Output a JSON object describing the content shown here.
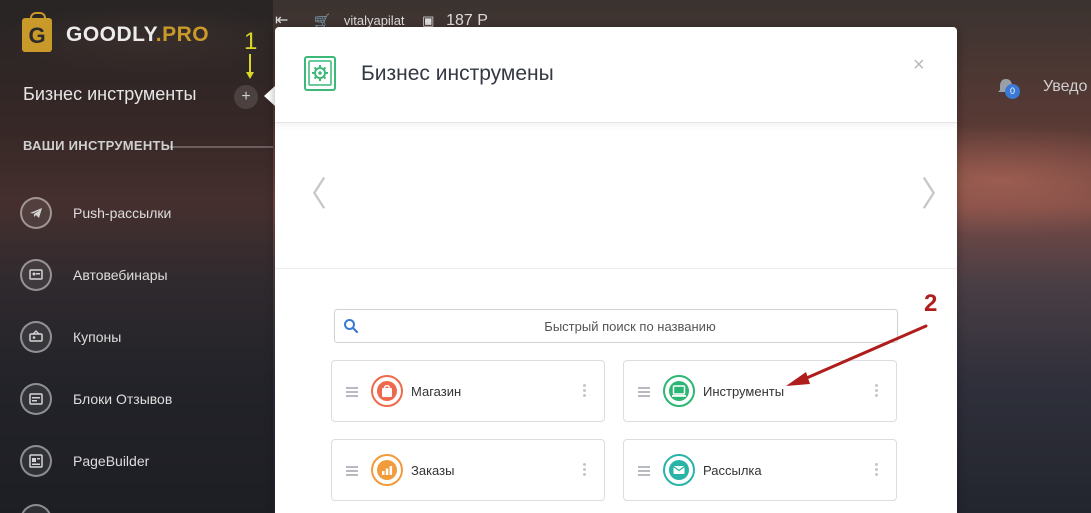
{
  "brand": {
    "logo_letter": "G",
    "name_main": "GOODLY",
    "name_pro": ".PRO",
    "accent": "#c99a2a"
  },
  "sidebar": {
    "title": "Бизнес инструменты",
    "add_label": "+",
    "tools_heading": "ВАШИ ИНСТРУМЕНТЫ",
    "items": [
      {
        "label": "Push-рассылки",
        "icon": "telegram-icon"
      },
      {
        "label": "Автовебинары",
        "icon": "presentation-icon"
      },
      {
        "label": "Купоны",
        "icon": "coupon-icon"
      },
      {
        "label": "Блоки Отзывов",
        "icon": "reviews-icon"
      },
      {
        "label": "PageBuilder",
        "icon": "pagebuilder-icon"
      }
    ]
  },
  "topbar": {
    "username": "vitalyapilat",
    "balance": "187 Р",
    "notifications_count": "0",
    "notifications_label": "Уведо"
  },
  "modal": {
    "title": "Бизнес инструмены",
    "close": "×",
    "prev": "〈",
    "next": "〉",
    "search_placeholder": "Быстрый поиск по названию",
    "tools": [
      {
        "label": "Магазин",
        "icon": "shopping-bag-icon",
        "color": "#ef6a4c"
      },
      {
        "label": "Инструменты",
        "icon": "laptop-icon",
        "color": "#2bb673"
      },
      {
        "label": "Заказы",
        "icon": "bar-chart-icon",
        "color": "#f29b3a"
      },
      {
        "label": "Рассылка",
        "icon": "envelope-icon",
        "color": "#28b4a6"
      }
    ]
  },
  "annotations": {
    "step1": "1",
    "step2": "2"
  }
}
